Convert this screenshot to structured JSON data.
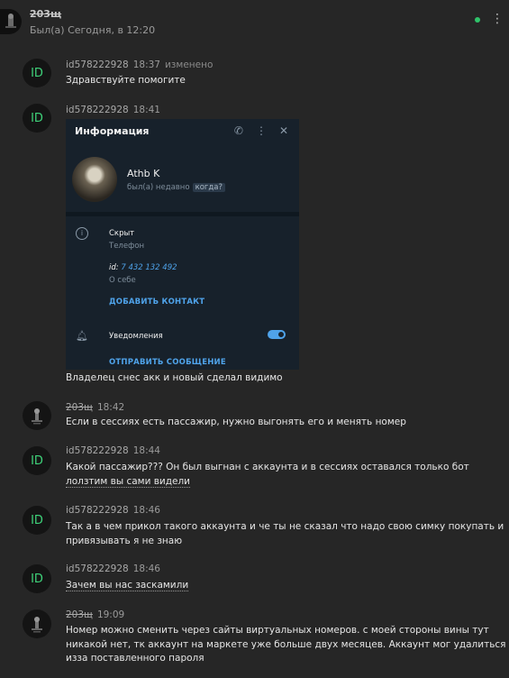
{
  "header": {
    "name": "203щ",
    "status": "Был(а) Сегодня, в 12:20"
  },
  "messages": [
    {
      "author": "id578222928",
      "time": "18:37",
      "edited": "изменено",
      "lines": [
        "Здравствуйте помогите"
      ]
    },
    {
      "author": "id578222928",
      "time": "18:41",
      "lines": [
        "Владелец снес акк и новый сделал видимо"
      ]
    },
    {
      "author": "203щ",
      "time": "18:42",
      "lines": [
        "Если в сессиях есть пассажир, нужно выгонять его и менять номер"
      ]
    },
    {
      "author": "id578222928",
      "time": "18:44",
      "lines": [
        "Какой пассажир??? Он был выгнан с аккаунта и в сессиях оставался только бот",
        "лолзтим вы сами видели"
      ]
    },
    {
      "author": "id578222928",
      "time": "18:46",
      "lines": [
        "Так а в чем прикол такого аккаунта и че ты не сказал что надо свою симку покупать и",
        "привязывать я не знаю"
      ]
    },
    {
      "author": "id578222928",
      "time": "18:46",
      "lines": [
        "Зачем вы нас заскамили"
      ]
    },
    {
      "author": "203щ",
      "time": "19:09",
      "lines": [
        "Номер можно сменить через сайты виртуальных номеров. с моей стороны вины тут",
        "никакой нет, тк аккаунт на маркете уже больше двух месяцев. Аккаунт мог удалиться",
        "изза поставленного пароля"
      ]
    }
  ],
  "avatar_text": "ID",
  "embedded": {
    "title": "Информация",
    "name": "Athb K",
    "seen": "был(а) недавно",
    "seen_q": "когда?",
    "phone_value": "Скрыт",
    "phone_label": "Телефон",
    "id_prefix": "id: ",
    "id_value": "7 432 132 492",
    "about_label": "О себе",
    "add_contact": "ДОБАВИТЬ КОНТАКТ",
    "notifications": "Уведомления",
    "send_message": "ОТПРАВИТЬ СООБЩЕНИЕ"
  },
  "colors": {
    "accent_green": "#2fc36a",
    "link_blue": "#4fa3ea"
  }
}
